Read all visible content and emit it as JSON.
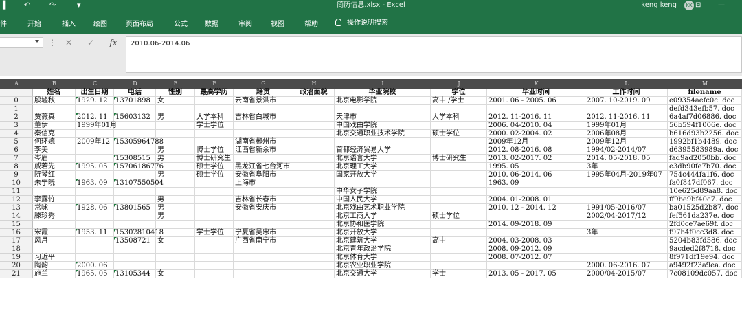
{
  "window": {
    "title": "简历信息.xlsx  -  Excel",
    "user": "keng keng",
    "avatar_initials": "KK",
    "brand_color": "#217346"
  },
  "quick_access": [
    {
      "name": "save-icon",
      "glyph": "▌"
    },
    {
      "name": "undo-icon",
      "glyph": "↶"
    },
    {
      "name": "redo-icon",
      "glyph": "↷"
    },
    {
      "name": "customize-icon",
      "glyph": "▾"
    }
  ],
  "window_controls": [
    {
      "name": "ribbon-display-icon",
      "glyph": "⊡"
    },
    {
      "name": "minimize-icon",
      "glyph": "—"
    }
  ],
  "ribbon": {
    "tabs": [
      "件",
      "开始",
      "插入",
      "绘图",
      "页面布局",
      "公式",
      "数据",
      "审阅",
      "视图",
      "帮助"
    ],
    "tell_me": "操作说明搜索"
  },
  "formula_bar": {
    "name_box": "",
    "cancel_glyph": "✕",
    "enter_glyph": "✓",
    "fx_label": "fx",
    "separator": "⋮",
    "value": "2010.06-2014.06"
  },
  "sheet": {
    "column_letters": [
      "A",
      "B",
      "C",
      "D",
      "E",
      "F",
      "G",
      "H",
      "I",
      "J",
      "K",
      "L",
      "M"
    ],
    "headers": [
      "",
      "姓名",
      "出生日期",
      "电话",
      "性别",
      "最高学历",
      "籍贯",
      "政治面貌",
      "毕业院校",
      "学位",
      "毕业时间",
      "工作时间",
      "filename"
    ],
    "rows": [
      [
        "0",
        "殷墟秋",
        "1929. 12",
        "13701898",
        "女",
        "",
        "云南省景洪市",
        "",
        "北京电影学院",
        "高中 /学士",
        "2001. 06 - 2005. 06",
        "2007. 10-2019. 09",
        "e09354aefc0c. doc"
      ],
      [
        "1",
        "",
        "",
        "",
        "",
        "",
        "",
        "",
        "",
        "",
        "",
        "",
        "defd343efb57. doc"
      ],
      [
        "2",
        "贾薇真",
        "2012. 11",
        "15603132",
        "男",
        "大学本科",
        "吉林省白城市",
        "",
        "天津市",
        "大学本科",
        "2012. 11-2016. 11",
        "2012. 11-2016. 11",
        "6a4af7d06886. doc"
      ],
      [
        "3",
        "董伊",
        "1999年01月",
        "",
        "",
        "学士学位",
        "",
        "",
        "中国戏曲学院",
        "",
        "2006. 04-2010. 04",
        "1999年01月",
        "56b594f1006e. doc"
      ],
      [
        "4",
        "秦信克",
        "",
        "",
        "",
        "",
        "",
        "",
        "北京交通职业技术学院",
        "硕士学位",
        "2000. 02-2004. 02",
        "2006年08月",
        "b616d93b2256. doc"
      ],
      [
        "5",
        "何环婉",
        "2009年12",
        "15305964788",
        "",
        "",
        "湖南省郴州市",
        "",
        "",
        "",
        "2009年12月",
        "2009年12月",
        "1992bf1b4489. doc"
      ],
      [
        "6",
        "李美",
        "",
        "",
        "男",
        "博士学位",
        "江西省新余市",
        "",
        "首都经济贸易大学",
        "",
        "2012. 08-2016. 08",
        "1994/02-2014/07",
        "d6395583989a. doc"
      ],
      [
        "7",
        "岑眉",
        "",
        "15308515",
        "男",
        "博士研究生",
        "",
        "",
        "北京语言大学",
        "博士研究生",
        "2013. 02-2017. 02",
        "2014. 05-2018. 05",
        "fad9ad2050bb. doc"
      ],
      [
        "8",
        "戚若先",
        "1995. 05",
        "15706186776",
        "",
        "硕士学位",
        "黑龙江省七台河市",
        "",
        "北京理工大学",
        "",
        "1995. 05",
        "3年",
        "e3db90fe7b70. doc"
      ],
      [
        "9",
        "阮琴红",
        "",
        "",
        "男",
        "硕士学位",
        "安徽省阜阳市",
        "",
        "国家开放大学",
        "",
        "2010. 06-2014. 06",
        "1995年04月-2019年07",
        "754c444fa1f6. doc"
      ],
      [
        "10",
        "朱宁晓",
        "1963. 09",
        "13107550504",
        "",
        "",
        "上海市",
        "",
        "",
        "",
        "1963. 09",
        "",
        "fa0f847df067. doc"
      ],
      [
        "11",
        "",
        "",
        "",
        "",
        "",
        "",
        "",
        "中华女子学院",
        "",
        "",
        "",
        "10e625d89aa8. doc"
      ],
      [
        "12",
        "李露竹",
        "",
        "",
        "男",
        "",
        "吉林省长春市",
        "",
        "中国人民大学",
        "",
        "2004. 01-2008. 01",
        "",
        "ff9be9bf40c7. doc"
      ],
      [
        "13",
        "常咏",
        "1928. 06",
        "13801565",
        "男",
        "",
        "安徽省安庆市",
        "",
        "北京戏曲艺术职业学院",
        "",
        "2010. 12 - 2014. 12",
        "1991/05-2016/07",
        "ba01525d2b87. doc"
      ],
      [
        "14",
        "滕珍秀",
        "",
        "",
        "男",
        "",
        "",
        "",
        "北京工商大学",
        "硕士学位",
        "",
        "2002/04-2017/12",
        "fef561da237e. doc"
      ],
      [
        "15",
        "",
        "",
        "",
        "",
        "",
        "",
        "",
        "北京协和医学院",
        "",
        "2014. 09-2018. 09",
        "",
        "2fd0ce7ae69f. doc"
      ],
      [
        "16",
        "宋霞",
        "1953. 11",
        "15302810418",
        "",
        "学士学位",
        "宁夏省吴忠市",
        "",
        "北京开放大学",
        "",
        "",
        "3年",
        "f97b4f0cc3d8. doc"
      ],
      [
        "17",
        "风月",
        "",
        "13508721",
        "女",
        "",
        "广西省南宁市",
        "",
        "北京建筑大学",
        "高中",
        "2004. 03-2008. 03",
        "",
        "5204b83fd586. doc"
      ],
      [
        "18",
        "",
        "",
        "",
        "",
        "",
        "",
        "",
        "北京青年政治学院",
        "",
        "2008. 09-2012. 09",
        "",
        "9acded2f8718. doc"
      ],
      [
        "19",
        "习近平",
        "",
        "",
        "",
        "",
        "",
        "",
        "北京体育大学",
        "",
        "2008. 07-2012. 07",
        "",
        "8f971df19e94. doc"
      ],
      [
        "20",
        "陶韵",
        "2000. 06",
        "",
        "",
        "",
        "",
        "",
        "北京农业职业学院",
        "",
        "",
        "2000. 06-2016. 07",
        "a9492f23a9ea. doc"
      ],
      [
        "21",
        "施兰",
        "1965. 05",
        "13105344",
        "女",
        "",
        "",
        "",
        "北京交通大学",
        "学士",
        "2013. 05 - 2017. 05",
        "2000/04-2015/07",
        "7c08109dc057. doc"
      ]
    ]
  }
}
